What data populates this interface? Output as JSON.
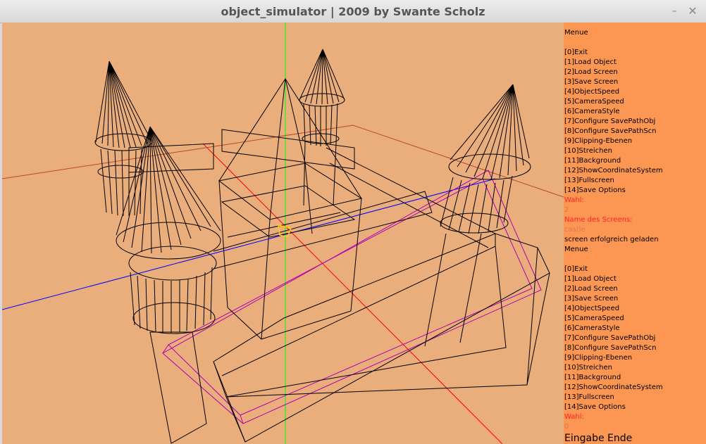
{
  "window": {
    "title": "object_simulator | 2009 by Swante Scholz",
    "minimize_glyph": "–",
    "maximize_glyph": "▫",
    "close_glyph": "✕"
  },
  "colors": {
    "viewport_bg": "#eaae7c",
    "panel_bg": "#fc9653",
    "prompt_text": "#ff2020",
    "input_text": "#d97b52",
    "axis_x": "#0000ff",
    "axis_y": "#00ff00",
    "axis_z": "#ff0000",
    "path": "#b000b0",
    "wireframe": "#000000"
  },
  "scene": {
    "description_icon": "castle-wireframe-3d-scene",
    "axes": [
      "x-axis",
      "y-axis",
      "z-axis"
    ]
  },
  "menu": {
    "lines": [
      {
        "text": "Menue",
        "style": "normal"
      },
      {
        "text": "",
        "style": "normal"
      },
      {
        "text": "[0]Exit",
        "style": "normal"
      },
      {
        "text": "[1]Load Object",
        "style": "normal"
      },
      {
        "text": "[2]Load Screen",
        "style": "normal"
      },
      {
        "text": "[3]Save Screen",
        "style": "normal"
      },
      {
        "text": "[4]ObjectSpeed",
        "style": "normal"
      },
      {
        "text": "[5]CameraSpeed",
        "style": "normal"
      },
      {
        "text": "[6]CameraStyle",
        "style": "normal"
      },
      {
        "text": "[7]Configure SavePathObj",
        "style": "normal"
      },
      {
        "text": "[8]Configure SavePathScn",
        "style": "normal"
      },
      {
        "text": "[9]Clipping-Ebenen",
        "style": "normal"
      },
      {
        "text": "[10]Streichen",
        "style": "normal"
      },
      {
        "text": "[11]Background",
        "style": "normal"
      },
      {
        "text": "[12]ShowCoordinateSystem",
        "style": "normal"
      },
      {
        "text": "[13]Fullscreen",
        "style": "normal"
      },
      {
        "text": "[14]Save Options",
        "style": "normal"
      },
      {
        "text": "Wahl:",
        "style": "prompt"
      },
      {
        "text": "2",
        "style": "input"
      },
      {
        "text": "Name des Screens:",
        "style": "prompt"
      },
      {
        "text": "castle",
        "style": "input"
      },
      {
        "text": "screen erfolgreich geladen",
        "style": "normal"
      },
      {
        "text": "Menue",
        "style": "normal"
      },
      {
        "text": "",
        "style": "normal"
      },
      {
        "text": "[0]Exit",
        "style": "normal"
      },
      {
        "text": "[1]Load Object",
        "style": "normal"
      },
      {
        "text": "[2]Load Screen",
        "style": "normal"
      },
      {
        "text": "[3]Save Screen",
        "style": "normal"
      },
      {
        "text": "[4]ObjectSpeed",
        "style": "normal"
      },
      {
        "text": "[5]CameraSpeed",
        "style": "normal"
      },
      {
        "text": "[6]CameraStyle",
        "style": "normal"
      },
      {
        "text": "[7]Configure SavePathObj",
        "style": "normal"
      },
      {
        "text": "[8]Configure SavePathScn",
        "style": "normal"
      },
      {
        "text": "[9]Clipping-Ebenen",
        "style": "normal"
      },
      {
        "text": "[10]Streichen",
        "style": "normal"
      },
      {
        "text": "[11]Background",
        "style": "normal"
      },
      {
        "text": "[12]ShowCoordinateSystem",
        "style": "normal"
      },
      {
        "text": "[13]Fullscreen",
        "style": "normal"
      },
      {
        "text": "[14]Save Options",
        "style": "normal"
      },
      {
        "text": "Wahl:",
        "style": "prompt"
      },
      {
        "text": "0",
        "style": "input"
      },
      {
        "text": "Eingabe Ende",
        "style": "big"
      }
    ]
  }
}
